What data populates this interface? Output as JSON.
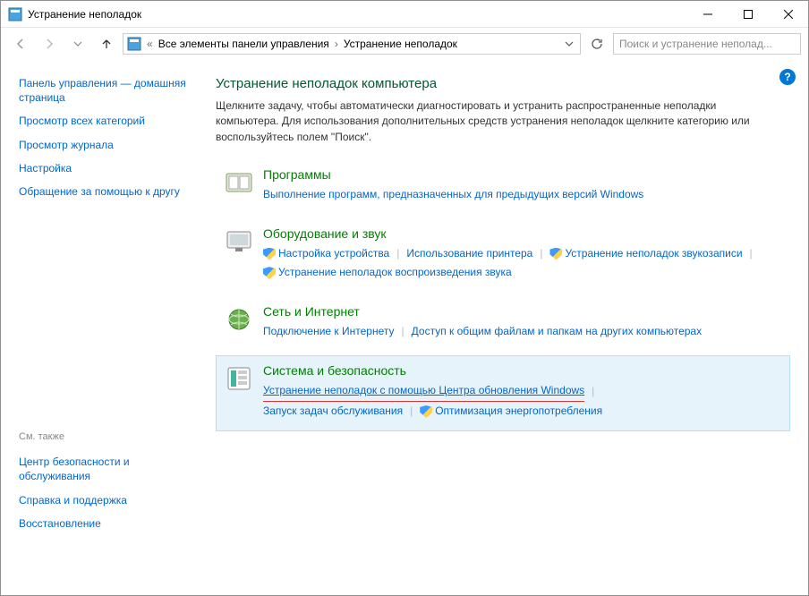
{
  "window": {
    "title": "Устранение неполадок"
  },
  "breadcrumb": {
    "root": "Все элементы панели управления",
    "current": "Устранение неполадок"
  },
  "search": {
    "placeholder": "Поиск и устранение неполад..."
  },
  "sidebar": {
    "home": "Панель управления — домашняя страница",
    "links": [
      "Просмотр всех категорий",
      "Просмотр журнала",
      "Настройка",
      "Обращение за помощью к другу"
    ],
    "seealso_header": "См. также",
    "seealso": [
      "Центр безопасности и обслуживания",
      "Справка и поддержка",
      "Восстановление"
    ]
  },
  "main": {
    "heading": "Устранение неполадок компьютера",
    "description": "Щелкните задачу, чтобы автоматически диагностировать и устранить распространенные неполадки компьютера. Для использования дополнительных средств устранения неполадок щелкните категорию или воспользуйтесь полем \"Поиск\"."
  },
  "categories": [
    {
      "title": "Программы",
      "links": [
        {
          "text": "Выполнение программ, предназначенных для предыдущих версий Windows",
          "shield": false
        }
      ]
    },
    {
      "title": "Оборудование и звук",
      "links": [
        {
          "text": "Настройка устройства",
          "shield": true
        },
        {
          "text": "Использование принтера",
          "shield": false
        },
        {
          "text": "Устранение неполадок звукозаписи",
          "shield": true
        },
        {
          "text": "Устранение неполадок воспроизведения звука",
          "shield": true
        }
      ]
    },
    {
      "title": "Сеть и Интернет",
      "links": [
        {
          "text": "Подключение к Интернету",
          "shield": false
        },
        {
          "text": "Доступ к общим файлам и папкам на других компьютерах",
          "shield": false
        }
      ]
    },
    {
      "title": "Система и безопасность",
      "selected": true,
      "links": [
        {
          "text": "Устранение неполадок с помощью Центра обновления Windows",
          "shield": false,
          "highlighted": true
        },
        {
          "text": "Запуск задач обслуживания",
          "shield": false
        },
        {
          "text": "Оптимизация энергопотребления",
          "shield": true
        }
      ]
    }
  ]
}
